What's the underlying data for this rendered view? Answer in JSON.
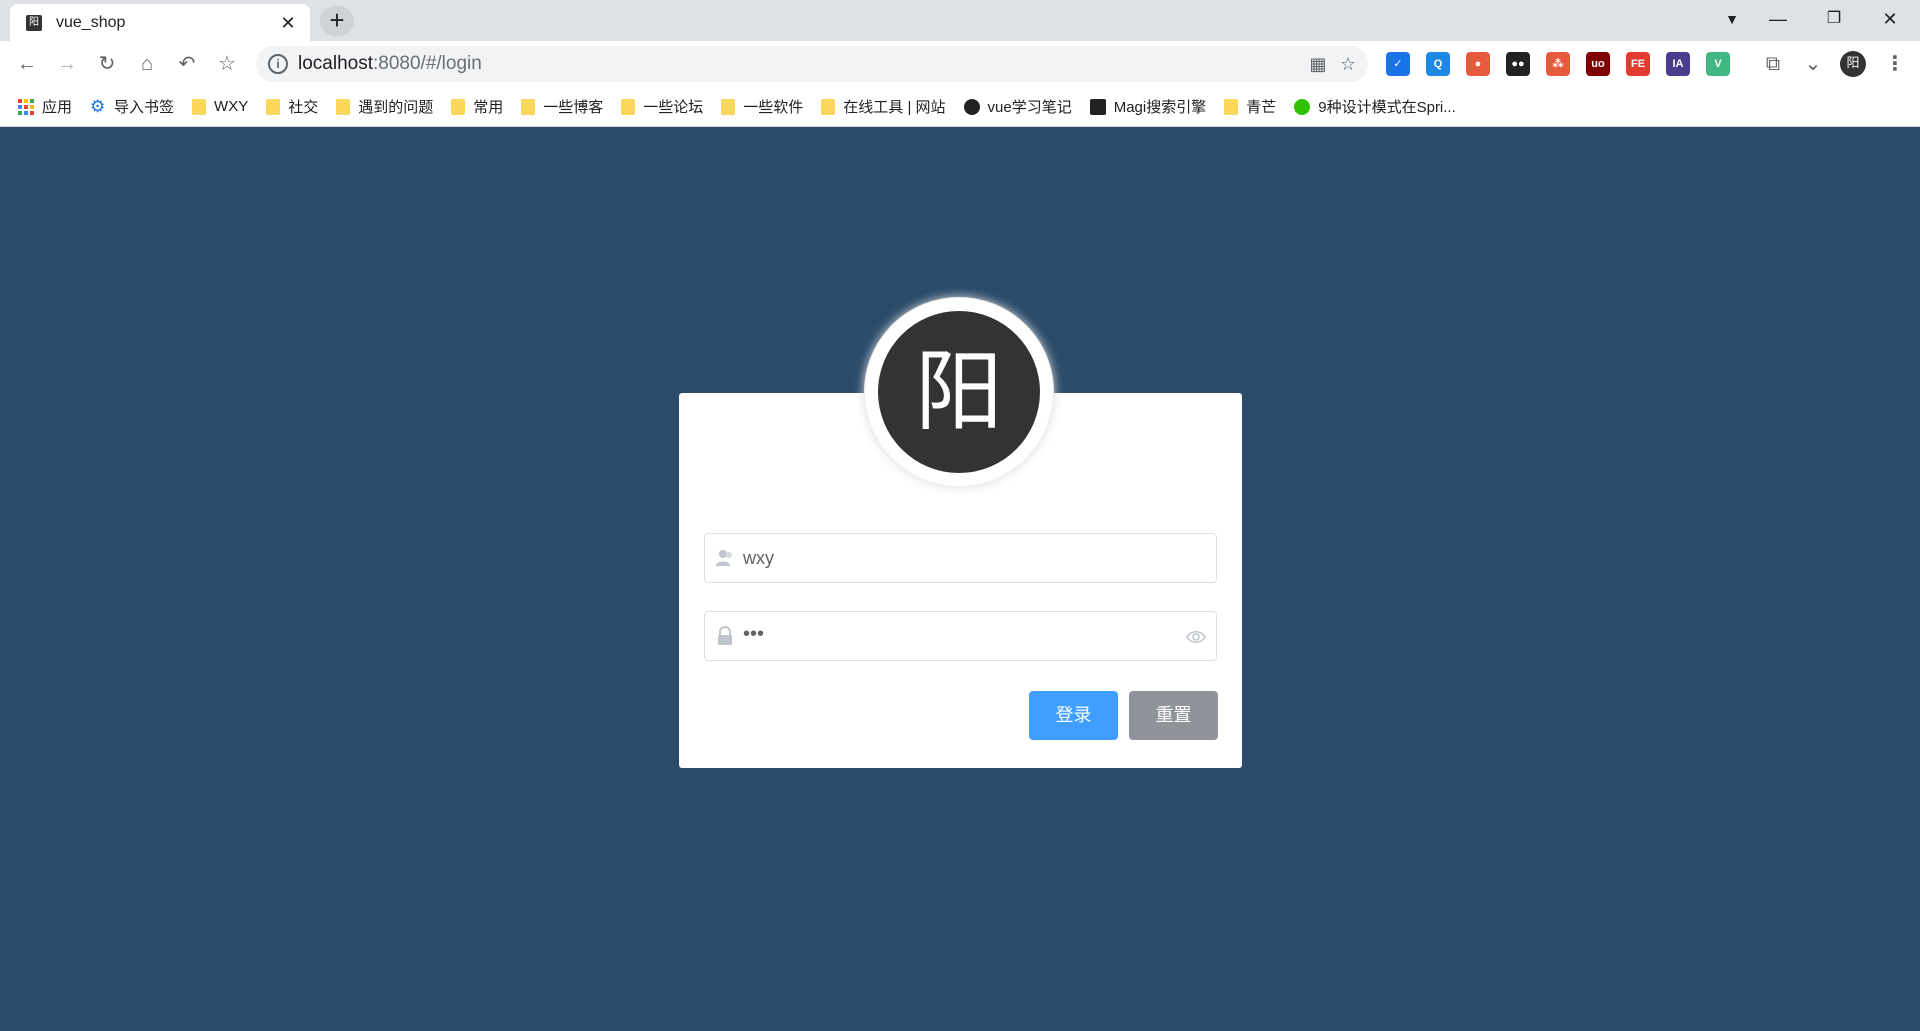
{
  "browser": {
    "tab": {
      "favicon_text": "阳",
      "title": "vue_shop"
    },
    "url_host": "localhost",
    "url_rest": ":8080/#/login",
    "profile_initial": "阳",
    "extensions": [
      {
        "name": "ext-pocket",
        "label": "✓",
        "color": "#1a73e8"
      },
      {
        "name": "ext-search",
        "label": "Q",
        "color": "#1e88e5"
      },
      {
        "name": "ext-location",
        "label": "●",
        "color": "#e8593d"
      },
      {
        "name": "ext-tampermonkey",
        "label": "●●",
        "color": "#222222"
      },
      {
        "name": "ext-network",
        "label": "⁂",
        "color": "#e8593d"
      },
      {
        "name": "ext-ublock",
        "label": "uo",
        "color": "#800000"
      },
      {
        "name": "ext-fe",
        "label": "FE",
        "color": "#e33a2f"
      },
      {
        "name": "ext-ia",
        "label": "IA",
        "color": "#4b3c8c"
      },
      {
        "name": "ext-vue",
        "label": "V",
        "color": "#41b883"
      }
    ]
  },
  "bookmarks": [
    {
      "label": "应用",
      "icon": "apps-icon"
    },
    {
      "label": "导入书签",
      "icon": "gear-icon"
    },
    {
      "label": "WXY",
      "icon": "folder-icon"
    },
    {
      "label": "社交",
      "icon": "folder-icon"
    },
    {
      "label": "遇到的问题",
      "icon": "folder-icon"
    },
    {
      "label": "常用",
      "icon": "folder-icon"
    },
    {
      "label": "一些博客",
      "icon": "folder-icon"
    },
    {
      "label": "一些论坛",
      "icon": "folder-icon"
    },
    {
      "label": "一些软件",
      "icon": "folder-icon"
    },
    {
      "label": "在线工具 | 网站",
      "icon": "folder-icon"
    },
    {
      "label": "vue学习笔记",
      "icon": "github-icon"
    },
    {
      "label": "Magi搜索引擎",
      "icon": "magi-icon"
    },
    {
      "label": "青芒",
      "icon": "folder-icon"
    },
    {
      "label": "9种设计模式在Spri...",
      "icon": "wechat-icon"
    }
  ],
  "login": {
    "avatar_text": "阳",
    "username_value": "wxy",
    "password_value": "•••",
    "login_label": "登录",
    "reset_label": "重置"
  },
  "colors": {
    "page_bg": "#2b4b6b",
    "primary": "#409eff",
    "info": "#909399"
  }
}
